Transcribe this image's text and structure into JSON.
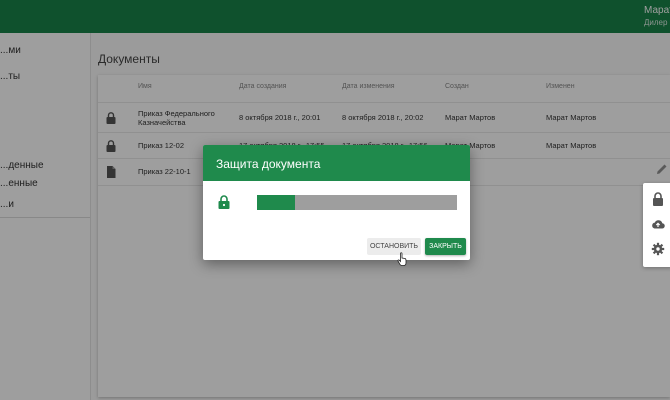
{
  "header": {
    "user_name": "Марат",
    "user_role": "Дилер"
  },
  "sidebar": {
    "items": [
      {
        "label": "...ми"
      },
      {
        "label": "...ты"
      },
      {
        "label": "...денные"
      },
      {
        "label": "...енные"
      },
      {
        "label": "...и"
      }
    ]
  },
  "main": {
    "title": "Документы",
    "columns": [
      "Имя",
      "Дата создания",
      "Дата изменения",
      "Создан",
      "Изменен"
    ],
    "rows": [
      {
        "icon": "lock-icon",
        "name": "Приказ Федерального Казначейства",
        "created": "8 октября 2018 г., 20:01",
        "modified": "8 октября 2018 г., 20:02",
        "created_by": "Марат Мартов",
        "modified_by": "Марат Мартов"
      },
      {
        "icon": "lock-icon",
        "name": "Приказ 12-02",
        "created": "17 октября 2018 г., 17:55",
        "modified": "17 октября 2018 г., 17:56",
        "created_by": "Марат Мартов",
        "modified_by": "Марат Мартов"
      },
      {
        "icon": "file-icon",
        "name": "Приказ 22-10-1",
        "created": "",
        "modified": "",
        "created_by": "",
        "modified_by": ""
      }
    ]
  },
  "dialog": {
    "title": "Защита документа",
    "progress": 0.19,
    "stop_label": "ОСТАНОВИТЬ",
    "close_label": "ЗАКРЫТЬ"
  },
  "side_menu": {
    "icons": [
      "lock-icon",
      "cloud-upload-icon",
      "gear-icon"
    ]
  },
  "colors": {
    "primary": "#19844a",
    "dialog_header": "#1f8a4c"
  }
}
